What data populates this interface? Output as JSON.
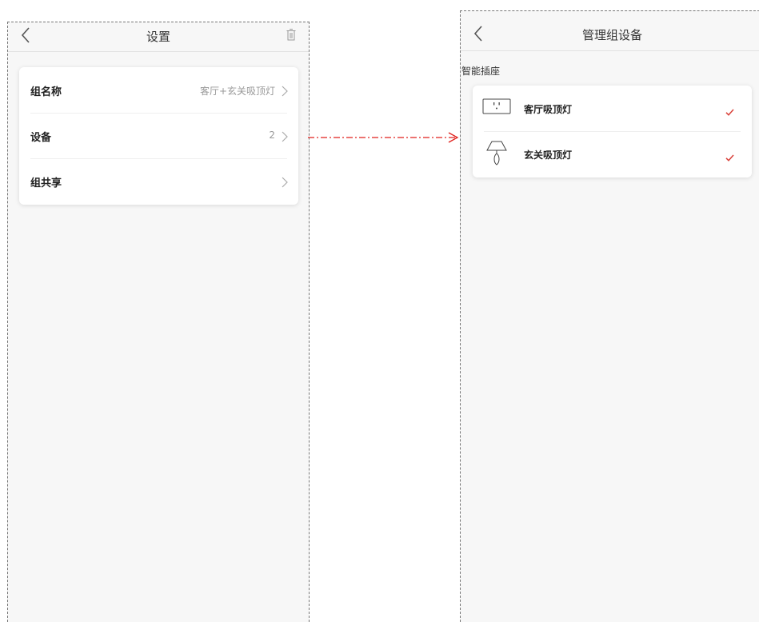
{
  "colors": {
    "screen_background": "#f7f7f7",
    "card_background": "#ffffff",
    "check_mark": "#d9413a",
    "flow_arrow": "#e0201c",
    "secondary_text": "#999999"
  },
  "settings_screen": {
    "title": "设置",
    "back_icon": "chevron-left-icon",
    "trash_icon": "trash-icon",
    "rows": [
      {
        "label": "组名称",
        "value": "客厅+玄关吸顶灯"
      },
      {
        "label": "设备",
        "value": "2"
      },
      {
        "label": "组共享",
        "value": ""
      }
    ]
  },
  "manage_screen": {
    "title": "管理组设备",
    "back_icon": "chevron-left-icon",
    "section_label": "智能插座",
    "devices": [
      {
        "name": "客厅吸顶灯",
        "icon": "smart-plug-icon",
        "selected": true
      },
      {
        "name": "玄关吸顶灯",
        "icon": "lamp-icon",
        "selected": true
      }
    ]
  }
}
